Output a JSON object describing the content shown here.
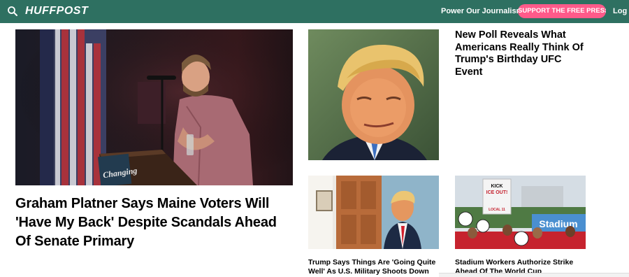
{
  "header": {
    "logo": "HUFFPOST",
    "nav_link": "Power Our Journalism",
    "support_button": "SUPPORT THE FREE PRESS",
    "login": "Log In",
    "bg_color": "#2e7061",
    "accent_color": "#ff5a8a"
  },
  "stories": {
    "lead": {
      "headline": "Graham Platner Says Maine Voters Will 'Have My Back' Despite Scandals Ahead Of Senate Primary",
      "image_text": "Changing"
    },
    "side": {
      "headline": "New Poll Reveals What Americans Really Think Of Trump's Birthday UFC Event"
    },
    "small_1": {
      "headline": "Trump Says Things Are 'Going Quite Well' As U.S. Military Shoots Down"
    },
    "small_2": {
      "headline": "Stadium Workers Authorize Strike Ahead Of The World Cup",
      "image_sign_1": "KICK",
      "image_sign_2": "ICE OUT!",
      "image_sign_3": "LOCAL 11",
      "image_banner": "Stadium"
    }
  }
}
